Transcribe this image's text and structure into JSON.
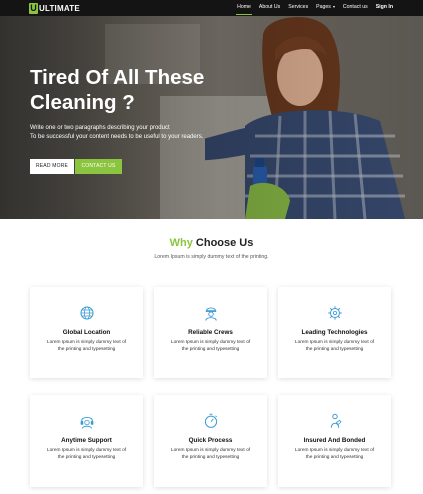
{
  "brand": {
    "logo_letter": "U",
    "name": "ULTIMATE",
    "accent": "#8bc53f"
  },
  "nav": {
    "items": [
      {
        "label": "Home"
      },
      {
        "label": "About Us"
      },
      {
        "label": "Services"
      },
      {
        "label": "Pages"
      },
      {
        "label": "Contact us"
      }
    ],
    "signin": "Sign In"
  },
  "hero": {
    "title": "Tired Of All These Cleaning ?",
    "desc_line1": "Write one or two paragraphs describing your product",
    "desc_line2": "To be successful your content needs to be useful to your readers.",
    "read_more": "READ MORE",
    "contact": "CONTACT US"
  },
  "why": {
    "title_highlight": "Why",
    "title_rest": "Choose Us",
    "subtitle": "Lorem Ipsum is simply dummy text of the printing."
  },
  "features": [
    {
      "title": "Global Location",
      "text_line1": "Lorem Ipsum is simply dummy text of",
      "text_line2": "the printing and typesetting",
      "icon": "globe-location-icon"
    },
    {
      "title": "Reliable Crews",
      "text_line1": "Lorem Ipsum is simply dummy text of",
      "text_line2": "the printing and typesetting",
      "icon": "crew-worker-icon"
    },
    {
      "title": "Leading Technologies",
      "text_line1": "Lorem Ipsum is simply dummy text of",
      "text_line2": "the printing and typesetting",
      "icon": "technology-gear-icon"
    },
    {
      "title": "Anytime Support",
      "text_line1": "Lorem Ipsum is simply dummy text of",
      "text_line2": "the printing and typesetting",
      "icon": "support-headset-icon"
    },
    {
      "title": "Quick Process",
      "text_line1": "Lorem Ipsum is simply dummy text of",
      "text_line2": "the printing and typesetting",
      "icon": "quick-timer-icon"
    },
    {
      "title": "Insured And Bonded",
      "text_line1": "Lorem Ipsum is simply dummy text of",
      "text_line2": "the printing and typesetting",
      "icon": "insured-person-icon"
    }
  ]
}
